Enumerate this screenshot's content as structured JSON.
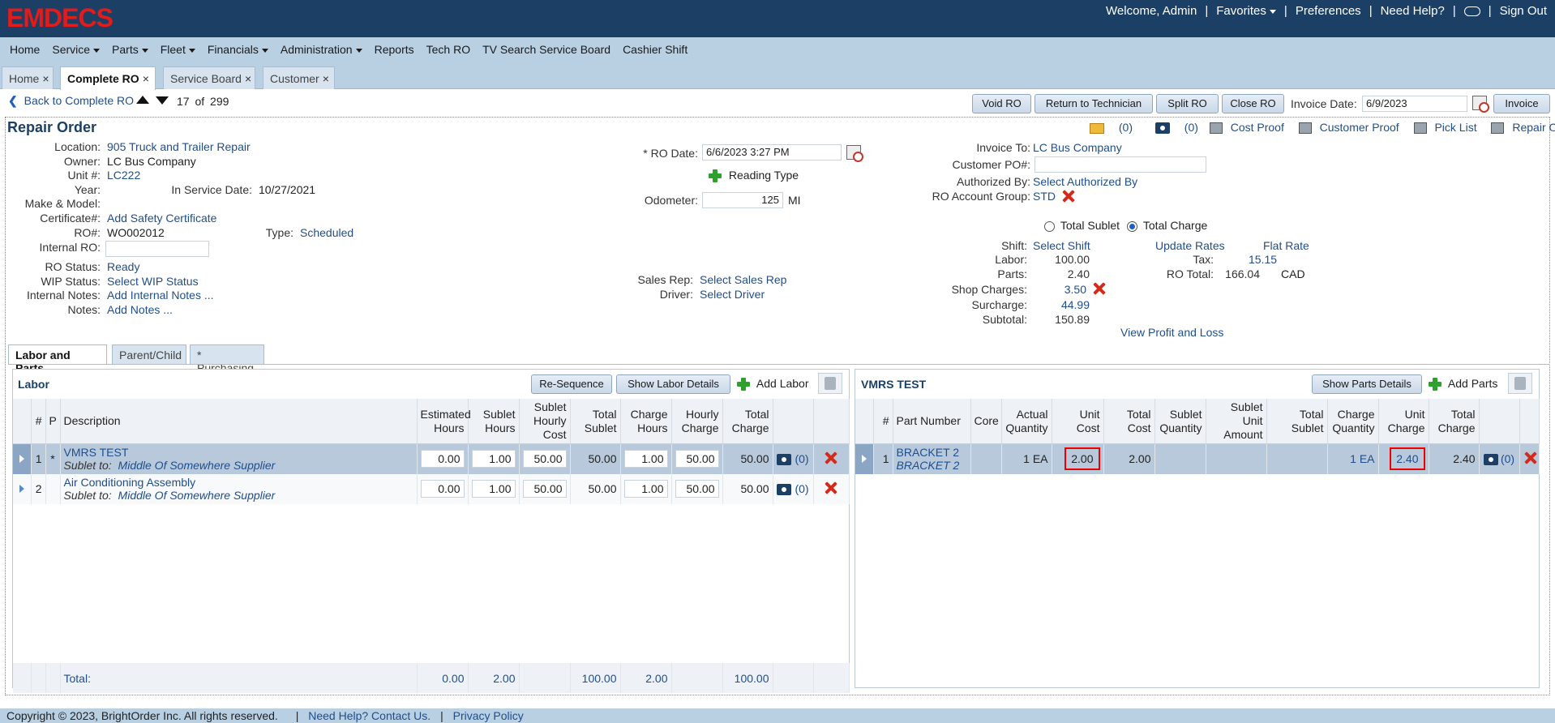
{
  "header": {
    "logo": "EMDECS",
    "welcome": "Welcome, Admin",
    "favorites": "Favorites",
    "preferences": "Preferences",
    "need_help": "Need Help?",
    "sign_out": "Sign Out"
  },
  "nav": [
    "Home",
    "Service",
    "Parts",
    "Fleet",
    "Financials",
    "Administration",
    "Reports",
    "Tech RO",
    "TV Search Service Board",
    "Cashier Shift"
  ],
  "tabs": [
    {
      "label": "Home"
    },
    {
      "label": "Complete RO"
    },
    {
      "label": "Service Board"
    },
    {
      "label": "Customer"
    }
  ],
  "toolbar": {
    "back": "Back to Complete RO",
    "position": "17",
    "of": "of",
    "total": "299",
    "void_ro": "Void RO",
    "return_tech": "Return to Technician",
    "split_ro": "Split RO",
    "close_ro": "Close RO",
    "invoice_date_label": "Invoice Date:",
    "invoice_date": "6/9/2023",
    "invoice": "Invoice"
  },
  "ro": {
    "title": "Repair Order",
    "mail_count": "(0)",
    "photo_count": "(0)",
    "cost_proof": "Cost Proof",
    "customer_proof": "Customer Proof",
    "pick_list": "Pick List",
    "repair_order": "Repair Order",
    "location_label": "Location:",
    "location": "905 Truck and Trailer Repair",
    "owner_label": "Owner:",
    "owner": "LC Bus Company",
    "unit_label": "Unit #:",
    "unit": "LC222",
    "year_label": "Year:",
    "in_service_label": "In Service Date:",
    "in_service": "10/27/2021",
    "make_label": "Make & Model:",
    "cert_label": "Certificate#:",
    "cert": "Add Safety Certificate",
    "ro_num_label": "RO#:",
    "ro_num": "WO002012",
    "type_label": "Type:",
    "type": "Scheduled",
    "internal_ro_label": "Internal RO:",
    "status_label": "RO Status:",
    "status": "Ready",
    "wip_label": "WIP Status:",
    "wip": "Select WIP Status",
    "internal_notes_label": "Internal Notes:",
    "internal_notes": "Add Internal Notes ...",
    "notes_label": "Notes:",
    "notes": "Add Notes ...",
    "ro_date_label": "* RO Date:",
    "ro_date": "6/6/2023 3:27 PM",
    "reading_type": "Reading Type",
    "odometer_label": "Odometer:",
    "odometer": "125",
    "odometer_unit": "MI",
    "sales_rep_label": "Sales Rep:",
    "sales_rep": "Select Sales Rep",
    "driver_label": "Driver:",
    "driver": "Select Driver",
    "invoice_to_label": "Invoice To:",
    "invoice_to": "LC Bus Company",
    "customer_po_label": "Customer PO#:",
    "authorized_label": "Authorized By:",
    "authorized": "Select Authorized By",
    "account_group_label": "RO Account Group:",
    "account_group": "STD",
    "total_sublet": "Total Sublet",
    "total_charge": "Total Charge",
    "shift_label": "Shift:",
    "shift": "Select Shift",
    "update_rates": "Update Rates",
    "flat_rate": "Flat Rate",
    "labor_label": "Labor:",
    "labor": "100.00",
    "tax_label": "Tax:",
    "tax": "15.15",
    "parts_label": "Parts:",
    "parts": "2.40",
    "ro_total_label": "RO Total:",
    "ro_total": "166.04",
    "currency": "CAD",
    "shop_charges_label": "Shop Charges:",
    "shop_charges": "3.50",
    "surcharge_label": "Surcharge:",
    "surcharge": "44.99",
    "subtotal_label": "Subtotal:",
    "subtotal": "150.89",
    "profit_loss": "View Profit and Loss"
  },
  "section_tabs": [
    "Labor and Parts",
    "Parent/Child",
    "* Purchasing"
  ],
  "labor": {
    "title": "Labor",
    "resequence": "Re-Sequence",
    "show_details": "Show Labor Details",
    "add": "Add Labor",
    "columns": [
      "#",
      "P",
      "Description",
      "Estimated Hours",
      "Sublet Hours",
      "Sublet Hourly Cost",
      "Total Sublet",
      "Charge Hours",
      "Hourly Charge",
      "Total Charge"
    ],
    "rows": [
      {
        "num": "1",
        "p": "*",
        "desc": "VMRS TEST",
        "sublet_to_label": "Sublet to:",
        "sublet_to": "Middle Of Somewhere Supplier",
        "est": "0.00",
        "sub_hrs": "1.00",
        "sub_cost": "50.00",
        "total_sublet": "50.00",
        "chg_hrs": "1.00",
        "hourly": "50.00",
        "total": "50.00",
        "photos": "(0)"
      },
      {
        "num": "2",
        "p": "",
        "desc": "Air Conditioning Assembly",
        "sublet_to_label": "Sublet to:",
        "sublet_to": "Middle Of Somewhere Supplier",
        "est": "0.00",
        "sub_hrs": "1.00",
        "sub_cost": "50.00",
        "total_sublet": "50.00",
        "chg_hrs": "1.00",
        "hourly": "50.00",
        "total": "50.00",
        "photos": "(0)"
      }
    ],
    "totals": {
      "label": "Total:",
      "est": "0.00",
      "sub_hrs": "2.00",
      "total_sublet": "100.00",
      "chg_hrs": "2.00",
      "total": "100.00"
    }
  },
  "parts": {
    "title": "VMRS TEST",
    "show_details": "Show Parts Details",
    "add": "Add Parts",
    "columns": [
      "#",
      "Part Number",
      "Core",
      "Actual Quantity",
      "Unit Cost",
      "Total Cost",
      "Sublet Quantity",
      "Sublet Unit Amount",
      "Total Sublet",
      "Charge Quantity",
      "Unit Charge",
      "Total Charge"
    ],
    "rows": [
      {
        "num": "1",
        "part": "BRACKET 2",
        "part_desc": "BRACKET 2",
        "core": "",
        "actual_qty": "1 EA",
        "unit_cost": "2.00",
        "total_cost": "2.00",
        "sublet_qty": "",
        "sublet_unit": "",
        "total_sublet": "",
        "charge_qty": "1 EA",
        "unit_charge": "2.40",
        "total_charge": "2.40",
        "photos": "(0)"
      }
    ]
  },
  "footer": {
    "copyright": "Copyright © 2023, BrightOrder Inc. All rights reserved.",
    "help": "Need Help? Contact Us.",
    "privacy": "Privacy Policy"
  },
  "colors": {
    "header": "#1c3f66",
    "nav": "#b9cfe2",
    "link": "#1f4e8c",
    "logo": "#e21b1b",
    "highlight": "#e00000"
  }
}
